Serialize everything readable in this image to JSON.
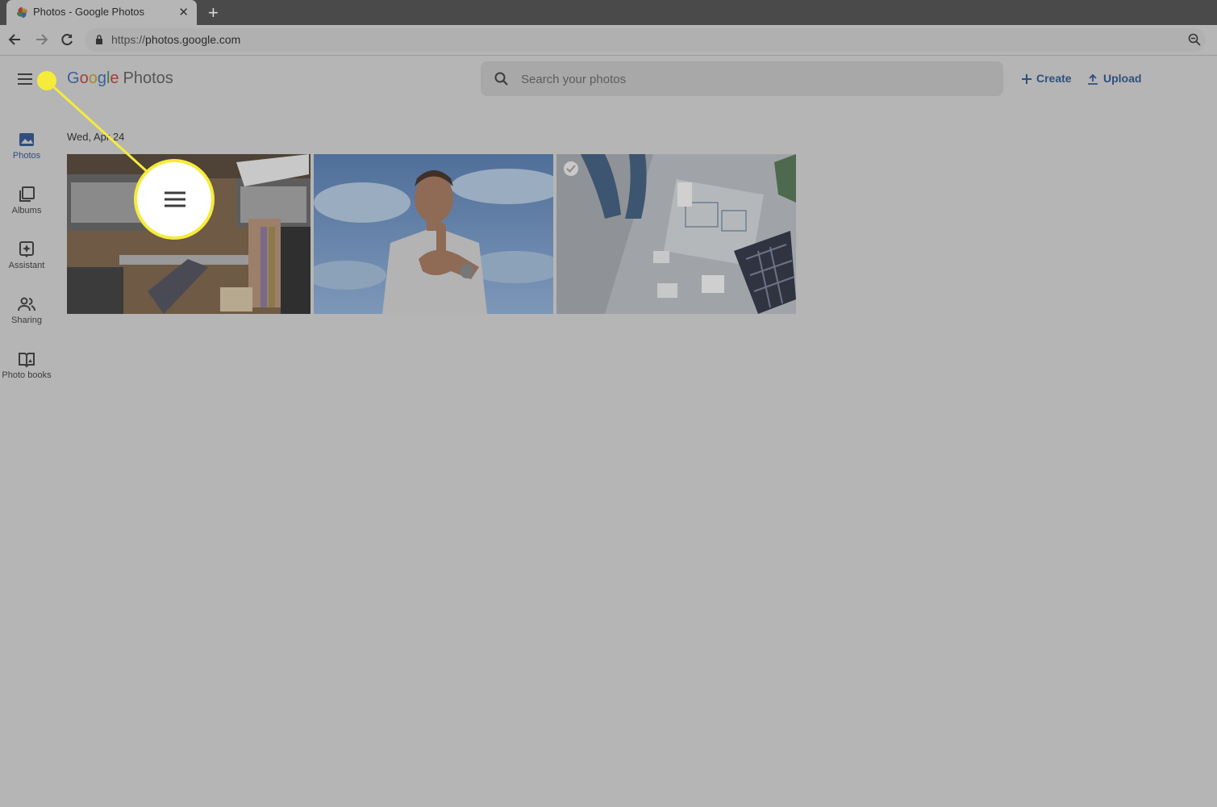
{
  "browser": {
    "tab_title": "Photos - Google Photos",
    "url_scheme": "https://",
    "url_host": "photos.google.com"
  },
  "header": {
    "logo_google": [
      "G",
      "o",
      "o",
      "g",
      "l",
      "e"
    ],
    "logo_product": "Photos",
    "search_placeholder": "Search your photos",
    "create_label": "Create",
    "upload_label": "Upload"
  },
  "nav": {
    "items": [
      {
        "label": "Photos",
        "icon": "photo-icon",
        "active": true
      },
      {
        "label": "Albums",
        "icon": "albums-icon"
      },
      {
        "label": "Assistant",
        "icon": "assistant-icon"
      },
      {
        "label": "Sharing",
        "icon": "sharing-icon"
      },
      {
        "label": "Photo books",
        "icon": "photo-books-icon"
      }
    ]
  },
  "content": {
    "date_label": "Wed, Apr 24",
    "photos": [
      {
        "subject": "laptops-desk-hands"
      },
      {
        "subject": "man-thumbs-up-sky"
      },
      {
        "subject": "solar-blueprint-desk"
      }
    ]
  },
  "colors": {
    "overlay": "#b5b5b5",
    "callout": "#f6eb3b",
    "accent": "#2f4f7d"
  }
}
